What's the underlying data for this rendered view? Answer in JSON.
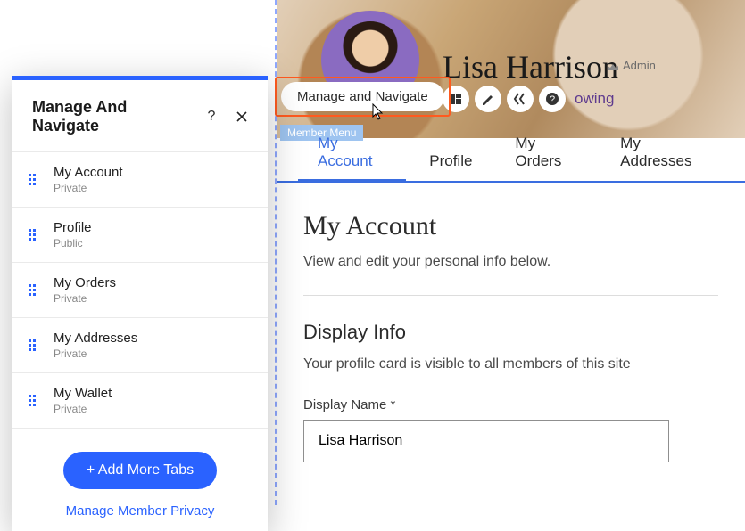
{
  "panel": {
    "title": "Manage And Navigate",
    "items": [
      {
        "label": "My Account",
        "visibility": "Private"
      },
      {
        "label": "Profile",
        "visibility": "Public"
      },
      {
        "label": "My Orders",
        "visibility": "Private"
      },
      {
        "label": "My Addresses",
        "visibility": "Private"
      },
      {
        "label": "My Wallet",
        "visibility": "Private"
      }
    ],
    "add_tabs_label": "+ Add More Tabs",
    "manage_privacy_label": "Manage Member Privacy"
  },
  "floating_button": {
    "label": "Manage and Navigate",
    "tag": "Member Menu"
  },
  "member": {
    "name": "Lisa Harrison",
    "role": "Admin",
    "following_suffix": "owing"
  },
  "tabs": [
    "My Account",
    "Profile",
    "My Orders",
    "My Addresses"
  ],
  "content": {
    "title": "My Account",
    "subtitle": "View and edit your personal info below.",
    "section_heading": "Display Info",
    "section_desc": "Your profile card is visible to all members of this site",
    "display_name_label": "Display Name *",
    "display_name_value": "Lisa Harrison"
  }
}
